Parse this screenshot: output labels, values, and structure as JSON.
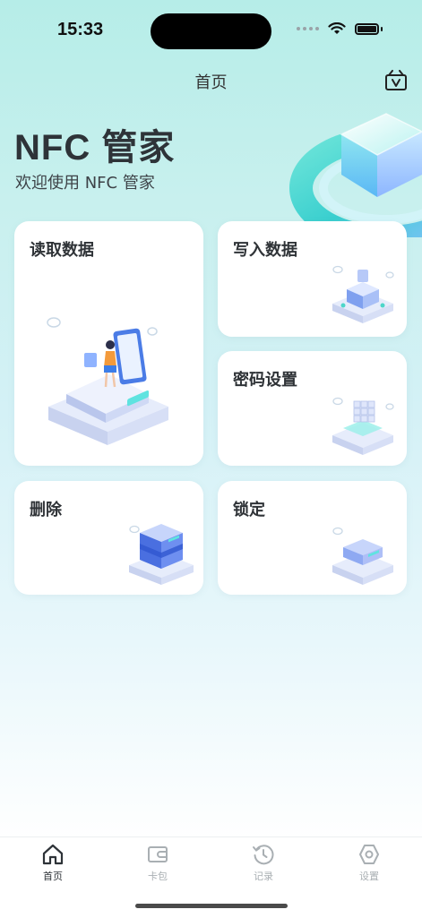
{
  "status_bar": {
    "time": "15:33"
  },
  "nav": {
    "title": "首页"
  },
  "hero": {
    "title": "NFC 管家",
    "subtitle": "欢迎使用 NFC 管家"
  },
  "cards": {
    "read": "读取数据",
    "write": "写入数据",
    "password": "密码设置",
    "delete": "删除",
    "lock": "锁定"
  },
  "tabs": [
    {
      "label": "首页",
      "icon": "home-icon",
      "active": true
    },
    {
      "label": "卡包",
      "icon": "wallet-icon",
      "active": false
    },
    {
      "label": "记录",
      "icon": "history-icon",
      "active": false
    },
    {
      "label": "设置",
      "icon": "settings-icon",
      "active": false
    }
  ],
  "colors": {
    "accent": "#4dd6c9",
    "text": "#2e3338",
    "inactive": "#a9afb3"
  }
}
